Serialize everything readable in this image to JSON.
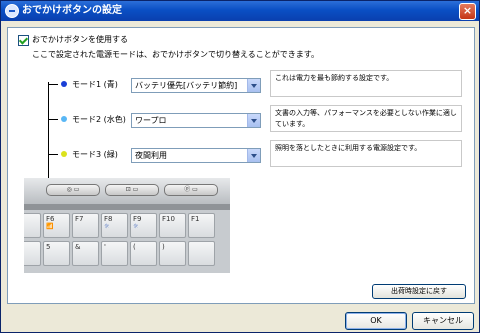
{
  "window": {
    "title": "おでかけボタンの設定",
    "close_label": "×"
  },
  "use_checkbox": {
    "label": "おでかけボタンを使用する",
    "checked": true
  },
  "description": "ここで設定された電源モードは、おでかけボタンで切り替えることができます。",
  "modes": [
    {
      "label": "モード1 (青)",
      "dot_color": "#1a3fd6",
      "selected": "バッテリ優先[バッテリ節約]",
      "info": "これは電力を最も節約する設定です。"
    },
    {
      "label": "モード2 (水色)",
      "dot_color": "#59b7f5",
      "selected": "ワープロ",
      "info": "文書の入力等、パフォーマンスを必要としない作業に適しています。"
    },
    {
      "label": "モード3 (緑)",
      "dot_color": "#dbe21c",
      "selected": "夜間利用",
      "info": "照明を落としたときに利用する電源設定です。"
    }
  ],
  "photo": {
    "keys": [
      {
        "main": "5",
        "sub": ""
      },
      {
        "main": "F6",
        "sub": "📶"
      },
      {
        "main": "F7",
        "sub": ""
      },
      {
        "main": "F8",
        "sub": "☼"
      },
      {
        "main": "F9",
        "sub": "☼"
      },
      {
        "main": "F10",
        "sub": ""
      },
      {
        "main": "F1",
        "sub": ""
      }
    ],
    "bottom_keys": [
      "%",
      "5",
      "&",
      "'",
      "(",
      ")",
      ""
    ]
  },
  "buttons": {
    "reset": "出荷時設定に戻す",
    "ok": "OK",
    "cancel": "キャンセル"
  }
}
